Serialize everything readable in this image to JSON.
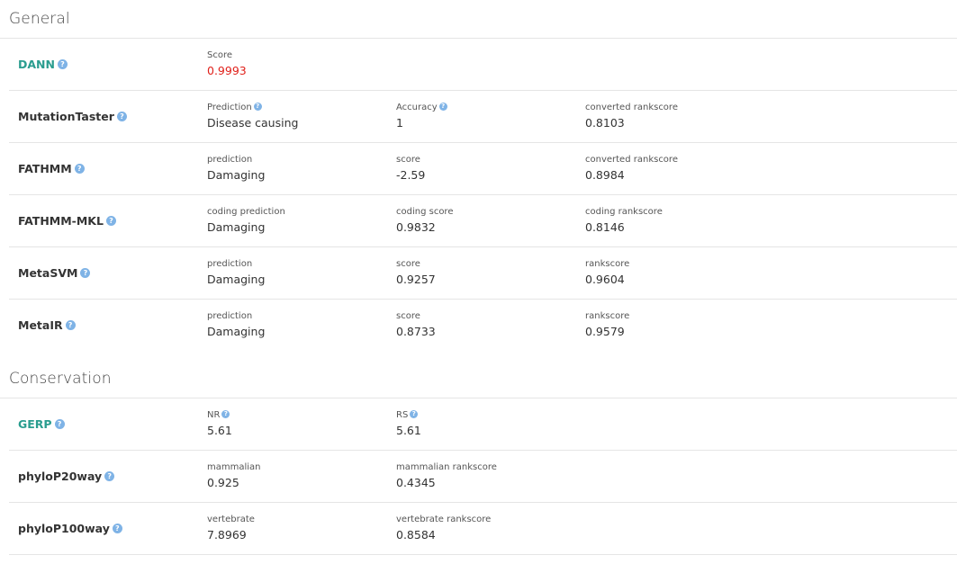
{
  "sections": {
    "general": {
      "title": "General",
      "rows": {
        "dann": {
          "name": "DANN",
          "fields": [
            {
              "label": "Score",
              "value": "0.9993"
            }
          ]
        },
        "mutationtaster": {
          "name": "MutationTaster",
          "fields": [
            {
              "label": "Prediction",
              "value": "Disease causing"
            },
            {
              "label": "Accuracy",
              "value": "1"
            },
            {
              "label": "converted rankscore",
              "value": "0.8103"
            }
          ]
        },
        "fathmm": {
          "name": "FATHMM",
          "fields": [
            {
              "label": "prediction",
              "value": "Damaging"
            },
            {
              "label": "score",
              "value": "-2.59"
            },
            {
              "label": "converted rankscore",
              "value": "0.8984"
            }
          ]
        },
        "fathmm_mkl": {
          "name": "FATHMM-MKL",
          "fields": [
            {
              "label": "coding prediction",
              "value": "Damaging"
            },
            {
              "label": "coding score",
              "value": "0.9832"
            },
            {
              "label": "coding rankscore",
              "value": "0.8146"
            }
          ]
        },
        "metasvm": {
          "name": "MetaSVM",
          "fields": [
            {
              "label": "prediction",
              "value": "Damaging"
            },
            {
              "label": "score",
              "value": "0.9257"
            },
            {
              "label": "rankscore",
              "value": "0.9604"
            }
          ]
        },
        "metalr": {
          "name": "MetaIR",
          "fields": [
            {
              "label": "prediction",
              "value": "Damaging"
            },
            {
              "label": "score",
              "value": "0.8733"
            },
            {
              "label": "rankscore",
              "value": "0.9579"
            }
          ]
        }
      }
    },
    "conservation": {
      "title": "Conservation",
      "rows": {
        "gerp": {
          "name": "GERP",
          "fields": [
            {
              "label": "NR",
              "value": "5.61"
            },
            {
              "label": "RS",
              "value": "5.61"
            }
          ]
        },
        "phylop20way": {
          "name": "phyloP20way",
          "fields": [
            {
              "label": "mammalian",
              "value": "0.925"
            },
            {
              "label": "mammalian rankscore",
              "value": "0.4345"
            }
          ]
        },
        "phylop100way": {
          "name": "phyloP100way",
          "fields": [
            {
              "label": "vertebrate",
              "value": "7.8969"
            },
            {
              "label": "vertebrate rankscore",
              "value": "0.8584"
            }
          ]
        }
      }
    }
  },
  "help_icon_glyph": "?",
  "colors": {
    "link": "#2a9d8f",
    "score_highlight": "#e0201a",
    "help_icon": "#7fb3e6",
    "divider": "#e5e5e5"
  }
}
